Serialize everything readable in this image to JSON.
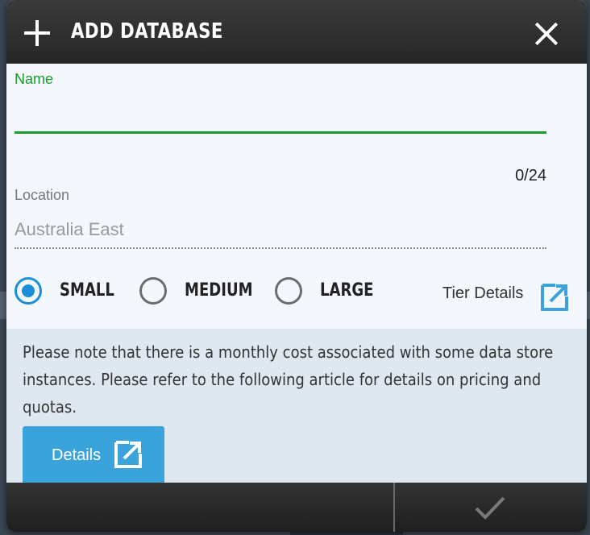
{
  "dialog": {
    "title": "ADD DATABASE",
    "plus_icon": "plus-icon",
    "close_icon": "close-icon"
  },
  "name_field": {
    "label": "Name",
    "value": "",
    "counter": "0/24",
    "accent_color": "#1a9a2a"
  },
  "location_field": {
    "label": "Location",
    "value": "Australia East"
  },
  "tiers": {
    "options": [
      {
        "label": "SMALL",
        "checked": true
      },
      {
        "label": "MEDIUM",
        "checked": false
      },
      {
        "label": "LARGE",
        "checked": false
      }
    ],
    "details_link": "Tier Details",
    "selected_color": "#1a8fd8"
  },
  "info": {
    "text": "Please note that there is a monthly cost associated with some data store instances. Please refer to the following article for details on pricing and quotas.",
    "details_button": "Details",
    "button_color": "#3aa3dc"
  },
  "footer": {
    "confirm_icon": "check-icon"
  }
}
